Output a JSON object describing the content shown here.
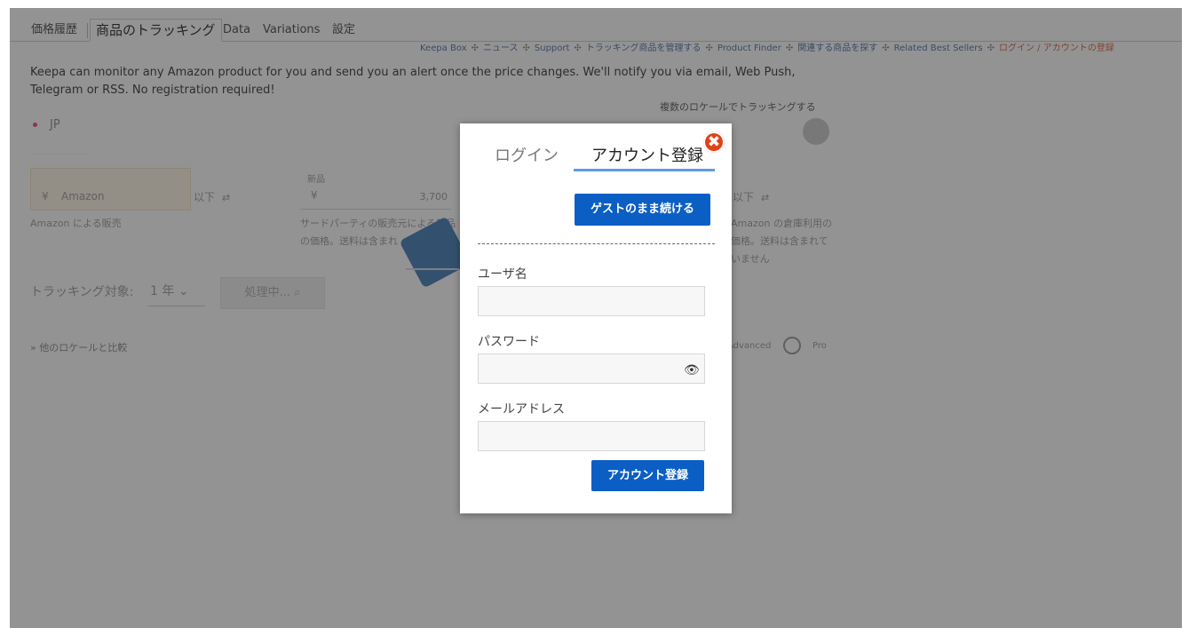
{
  "tabs": [
    "価格履歴",
    "商品のトラッキング",
    "Data",
    "Variations",
    "設定"
  ],
  "top_links": [
    "Keepa Box",
    "ニュース",
    "Support",
    "トラッキング商品を管理する",
    "Product Finder",
    "関連する商品を探す",
    "Related Best Sellers"
  ],
  "login_link": "ログイン / アカウントの登録",
  "link_separator": "✣",
  "intro_text": "Keepa can monitor any Amazon product for you and send you an alert once the price changes. We'll notify you via email, Web Push, Telegram or RSS. No registration required!",
  "multi_locale_label": "複数のロケールでトラッキングする",
  "locale": "JP",
  "price_boxes": {
    "amazon": {
      "currency": "¥",
      "placeholder": "Amazon",
      "below_label": "以下",
      "desc": "Amazon による販売"
    },
    "new": {
      "label": "新品",
      "currency": "¥",
      "value": "3,700",
      "desc": "サードパーティの販売元による新品の価格。送料は含まれ"
    },
    "fba": {
      "below_label": "以下",
      "desc": "Amazon の倉庫利用の価格。送料は含まれていません"
    }
  },
  "tracking": {
    "label": "トラッキング対象:",
    "duration": "1 年",
    "button": "処理中... "
  },
  "compare_link": "» 他のロケールと比較",
  "advanced_label": "Advanced",
  "pro_label": "Pro",
  "modal": {
    "tab_login": "ログイン",
    "tab_register": "アカウント登録",
    "close_symbol": "✖",
    "guest_button": "ゲストのまま続ける",
    "username_label": "ユーザ名",
    "username_value": "",
    "password_label": "パスワード",
    "password_value": "",
    "email_label": "メールアドレス",
    "email_value": "",
    "eye_symbol": "👁",
    "register_button": "アカウント登録"
  },
  "colors": {
    "primary_button": "#0b5fc4",
    "close_icon": "#e04318",
    "active_tab_underline": "#5b9de0",
    "login_link": "#d85b3a"
  }
}
